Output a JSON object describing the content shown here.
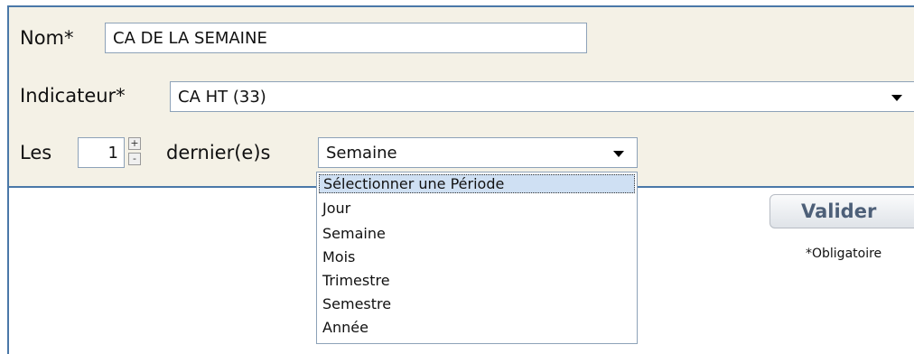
{
  "form": {
    "name_label": "Nom*",
    "name_value": "CA DE LA SEMAINE",
    "indicator_label": "Indicateur*",
    "indicator_value": "CA HT (33)",
    "les_label": "Les",
    "count_value": "1",
    "spin_up": "+",
    "spin_down": "-",
    "dernier_label": "dernier(e)s",
    "period_value": "Semaine"
  },
  "period_options": [
    "Sélectionner une Période",
    "Jour",
    "Semaine",
    "Mois",
    "Trimestre",
    "Semestre",
    "Année"
  ],
  "actions": {
    "validate_label": "Valider",
    "mandatory_note": "*Obligatoire"
  }
}
